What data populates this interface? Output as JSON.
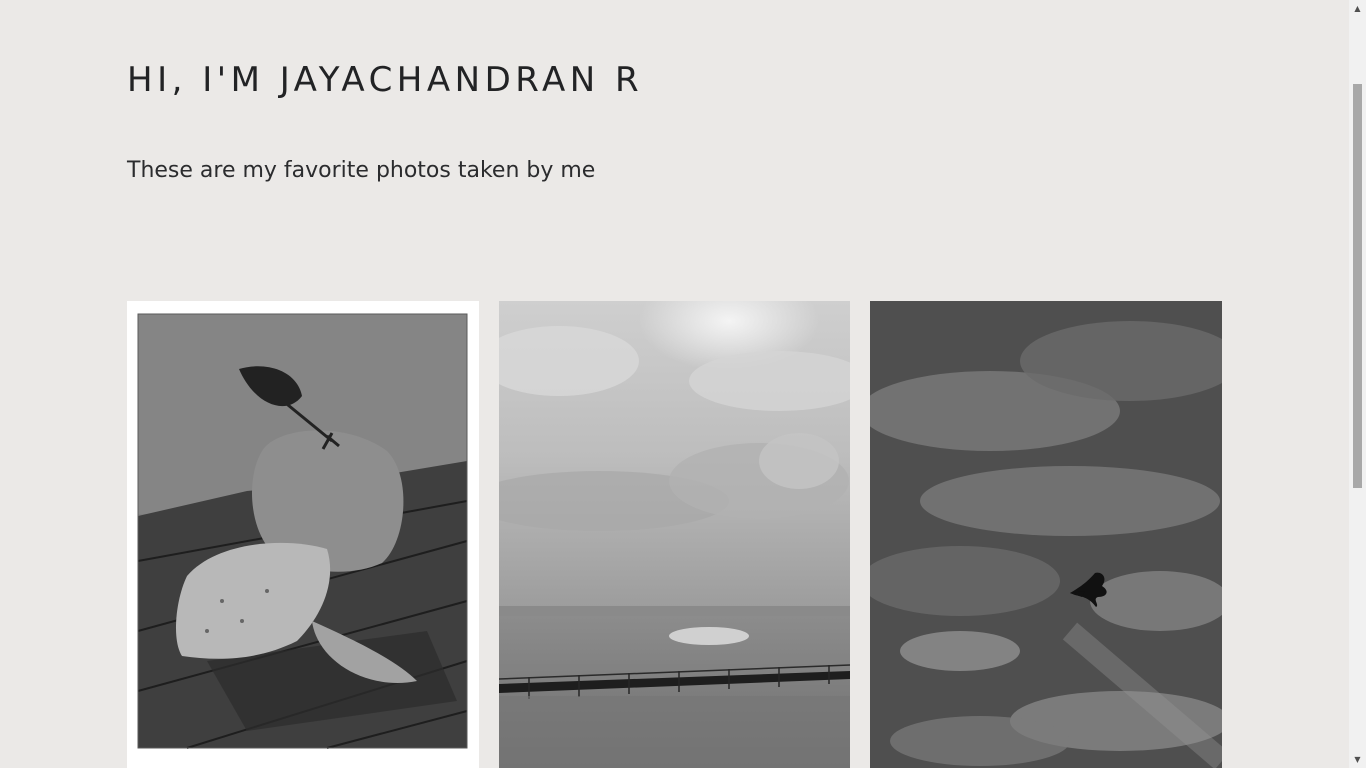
{
  "header": {
    "title": "HI, I'M JAYACHANDRAN R",
    "subtitle": "These are my favorite photos taken by me"
  },
  "gallery": {
    "photos": [
      {
        "description": "still life painting of fruits"
      },
      {
        "description": "lake with clouds and pier"
      },
      {
        "description": "bird flying in cloudy sky"
      }
    ]
  },
  "scrollbar": {
    "up_icon": "▲",
    "down_icon": "▼"
  }
}
